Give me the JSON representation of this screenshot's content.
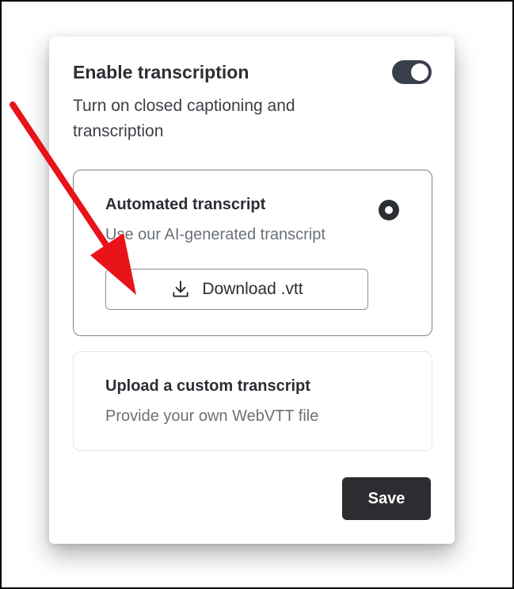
{
  "transcription": {
    "title": "Enable transcription",
    "description": "Turn on closed captioning and transcription",
    "enabled": true
  },
  "options": {
    "automated": {
      "title": "Automated transcript",
      "description": "Use our AI-generated transcript",
      "selected": true,
      "download_label": "Download .vtt"
    },
    "custom": {
      "title": "Upload a custom transcript",
      "description": "Provide your own WebVTT file",
      "selected": false
    }
  },
  "actions": {
    "save_label": "Save"
  },
  "colors": {
    "toggle_on": "#3a3f4e",
    "save_button": "#2b2d31",
    "annotation_arrow": "#e8141a"
  },
  "icons": {
    "download": "download-icon"
  }
}
